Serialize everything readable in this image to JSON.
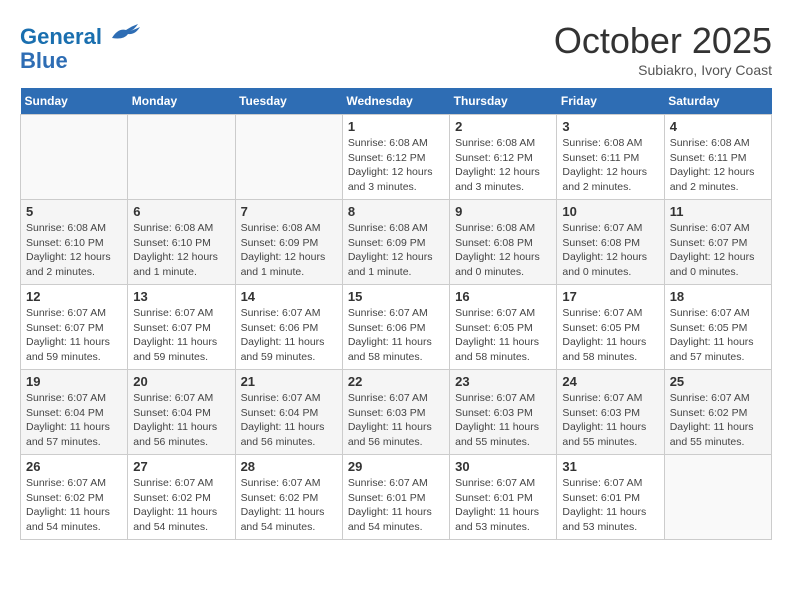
{
  "header": {
    "logo_line1": "General",
    "logo_line2": "Blue",
    "month": "October 2025",
    "location": "Subiakro, Ivory Coast"
  },
  "days_of_week": [
    "Sunday",
    "Monday",
    "Tuesday",
    "Wednesday",
    "Thursday",
    "Friday",
    "Saturday"
  ],
  "weeks": [
    [
      {
        "day": "",
        "info": ""
      },
      {
        "day": "",
        "info": ""
      },
      {
        "day": "",
        "info": ""
      },
      {
        "day": "1",
        "info": "Sunrise: 6:08 AM\nSunset: 6:12 PM\nDaylight: 12 hours and 3 minutes."
      },
      {
        "day": "2",
        "info": "Sunrise: 6:08 AM\nSunset: 6:12 PM\nDaylight: 12 hours and 3 minutes."
      },
      {
        "day": "3",
        "info": "Sunrise: 6:08 AM\nSunset: 6:11 PM\nDaylight: 12 hours and 2 minutes."
      },
      {
        "day": "4",
        "info": "Sunrise: 6:08 AM\nSunset: 6:11 PM\nDaylight: 12 hours and 2 minutes."
      }
    ],
    [
      {
        "day": "5",
        "info": "Sunrise: 6:08 AM\nSunset: 6:10 PM\nDaylight: 12 hours and 2 minutes."
      },
      {
        "day": "6",
        "info": "Sunrise: 6:08 AM\nSunset: 6:10 PM\nDaylight: 12 hours and 1 minute."
      },
      {
        "day": "7",
        "info": "Sunrise: 6:08 AM\nSunset: 6:09 PM\nDaylight: 12 hours and 1 minute."
      },
      {
        "day": "8",
        "info": "Sunrise: 6:08 AM\nSunset: 6:09 PM\nDaylight: 12 hours and 1 minute."
      },
      {
        "day": "9",
        "info": "Sunrise: 6:08 AM\nSunset: 6:08 PM\nDaylight: 12 hours and 0 minutes."
      },
      {
        "day": "10",
        "info": "Sunrise: 6:07 AM\nSunset: 6:08 PM\nDaylight: 12 hours and 0 minutes."
      },
      {
        "day": "11",
        "info": "Sunrise: 6:07 AM\nSunset: 6:07 PM\nDaylight: 12 hours and 0 minutes."
      }
    ],
    [
      {
        "day": "12",
        "info": "Sunrise: 6:07 AM\nSunset: 6:07 PM\nDaylight: 11 hours and 59 minutes."
      },
      {
        "day": "13",
        "info": "Sunrise: 6:07 AM\nSunset: 6:07 PM\nDaylight: 11 hours and 59 minutes."
      },
      {
        "day": "14",
        "info": "Sunrise: 6:07 AM\nSunset: 6:06 PM\nDaylight: 11 hours and 59 minutes."
      },
      {
        "day": "15",
        "info": "Sunrise: 6:07 AM\nSunset: 6:06 PM\nDaylight: 11 hours and 58 minutes."
      },
      {
        "day": "16",
        "info": "Sunrise: 6:07 AM\nSunset: 6:05 PM\nDaylight: 11 hours and 58 minutes."
      },
      {
        "day": "17",
        "info": "Sunrise: 6:07 AM\nSunset: 6:05 PM\nDaylight: 11 hours and 58 minutes."
      },
      {
        "day": "18",
        "info": "Sunrise: 6:07 AM\nSunset: 6:05 PM\nDaylight: 11 hours and 57 minutes."
      }
    ],
    [
      {
        "day": "19",
        "info": "Sunrise: 6:07 AM\nSunset: 6:04 PM\nDaylight: 11 hours and 57 minutes."
      },
      {
        "day": "20",
        "info": "Sunrise: 6:07 AM\nSunset: 6:04 PM\nDaylight: 11 hours and 56 minutes."
      },
      {
        "day": "21",
        "info": "Sunrise: 6:07 AM\nSunset: 6:04 PM\nDaylight: 11 hours and 56 minutes."
      },
      {
        "day": "22",
        "info": "Sunrise: 6:07 AM\nSunset: 6:03 PM\nDaylight: 11 hours and 56 minutes."
      },
      {
        "day": "23",
        "info": "Sunrise: 6:07 AM\nSunset: 6:03 PM\nDaylight: 11 hours and 55 minutes."
      },
      {
        "day": "24",
        "info": "Sunrise: 6:07 AM\nSunset: 6:03 PM\nDaylight: 11 hours and 55 minutes."
      },
      {
        "day": "25",
        "info": "Sunrise: 6:07 AM\nSunset: 6:02 PM\nDaylight: 11 hours and 55 minutes."
      }
    ],
    [
      {
        "day": "26",
        "info": "Sunrise: 6:07 AM\nSunset: 6:02 PM\nDaylight: 11 hours and 54 minutes."
      },
      {
        "day": "27",
        "info": "Sunrise: 6:07 AM\nSunset: 6:02 PM\nDaylight: 11 hours and 54 minutes."
      },
      {
        "day": "28",
        "info": "Sunrise: 6:07 AM\nSunset: 6:02 PM\nDaylight: 11 hours and 54 minutes."
      },
      {
        "day": "29",
        "info": "Sunrise: 6:07 AM\nSunset: 6:01 PM\nDaylight: 11 hours and 54 minutes."
      },
      {
        "day": "30",
        "info": "Sunrise: 6:07 AM\nSunset: 6:01 PM\nDaylight: 11 hours and 53 minutes."
      },
      {
        "day": "31",
        "info": "Sunrise: 6:07 AM\nSunset: 6:01 PM\nDaylight: 11 hours and 53 minutes."
      },
      {
        "day": "",
        "info": ""
      }
    ]
  ]
}
